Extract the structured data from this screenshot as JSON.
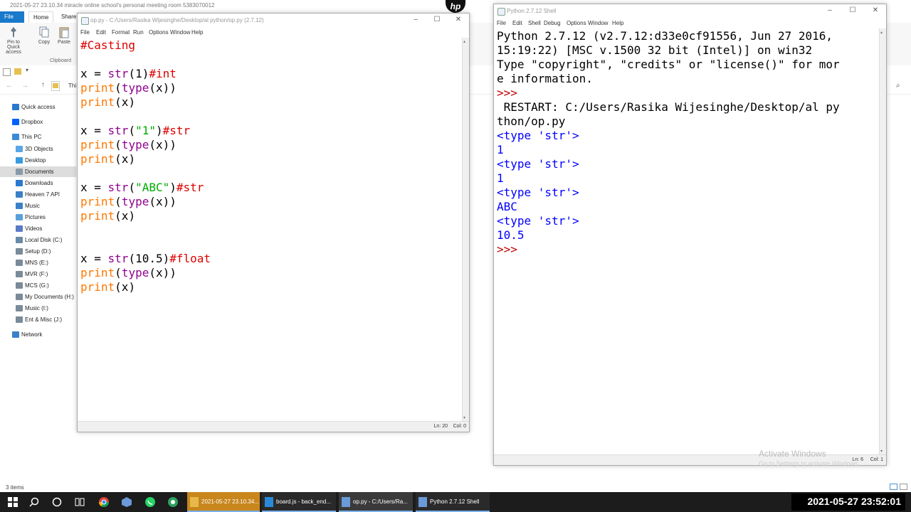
{
  "explorer": {
    "title": "2021-05-27 23.10.34 miracle online school's personal meeting room 5383070012",
    "tabs": {
      "file": "File",
      "home": "Home",
      "share": "Share"
    },
    "ribbon": {
      "pin": "Pin to Quick access",
      "copy": "Copy",
      "paste": "Paste",
      "group": "Clipboard"
    },
    "address_fragment": "Thi",
    "nav": [
      {
        "label": "Quick access",
        "icon": "star-icon",
        "color": "#2b78d0"
      },
      {
        "label": "Dropbox",
        "icon": "dropbox-icon",
        "color": "#0061fe"
      },
      {
        "label": "This PC",
        "icon": "computer-icon",
        "color": "#3b8ad8"
      },
      {
        "label": "3D Objects",
        "icon": "cube-icon",
        "color": "#58a6e8"
      },
      {
        "label": "Desktop",
        "icon": "desktop-icon",
        "color": "#3a9ae0"
      },
      {
        "label": "Documents",
        "icon": "document-icon",
        "color": "#8a9aa8"
      },
      {
        "label": "Downloads",
        "icon": "download-icon",
        "color": "#2b78d0"
      },
      {
        "label": "Heaven 7 API",
        "icon": "folder-icon",
        "color": "#3a80c8"
      },
      {
        "label": "Music",
        "icon": "music-icon",
        "color": "#3a80c8"
      },
      {
        "label": "Pictures",
        "icon": "pictures-icon",
        "color": "#5aa0d8"
      },
      {
        "label": "Videos",
        "icon": "video-icon",
        "color": "#5a7ac8"
      },
      {
        "label": "Local Disk (C:)",
        "icon": "drive-icon",
        "color": "#6a8aa8"
      },
      {
        "label": "Setup (D:)",
        "icon": "drive-icon",
        "color": "#7a8a98"
      },
      {
        "label": "MNS (E:)",
        "icon": "drive-icon",
        "color": "#7a8a98"
      },
      {
        "label": "MVR (F:)",
        "icon": "drive-icon",
        "color": "#7a8a98"
      },
      {
        "label": "MCS (G:)",
        "icon": "drive-icon",
        "color": "#7a8a98"
      },
      {
        "label": "My Documents (H:)",
        "icon": "drive-icon",
        "color": "#7a8a98"
      },
      {
        "label": "Music (I:)",
        "icon": "drive-icon",
        "color": "#7a8a98"
      },
      {
        "label": "Ent & Misc (J:)",
        "icon": "drive-icon",
        "color": "#7a8a98"
      },
      {
        "label": "Network",
        "icon": "network-icon",
        "color": "#3a80c8"
      }
    ],
    "status": "3 items"
  },
  "editor": {
    "title": "op.py - C:/Users/Rasika Wijesinghe/Desktop/al python/op.py (2.7.12)",
    "menu": [
      "File",
      "Edit",
      "Format",
      "Run",
      "Options",
      "Window",
      "Help"
    ],
    "code_lines": [
      [
        {
          "t": "#Casting",
          "c": "cm"
        }
      ],
      [],
      [
        {
          "t": "x = ",
          "c": ""
        },
        {
          "t": "str",
          "c": "bi"
        },
        {
          "t": "(1)",
          "c": ""
        },
        {
          "t": "#int",
          "c": "cm"
        }
      ],
      [
        {
          "t": "print",
          "c": "kw"
        },
        {
          "t": "(",
          "c": ""
        },
        {
          "t": "type",
          "c": "bi"
        },
        {
          "t": "(x))",
          "c": ""
        }
      ],
      [
        {
          "t": "print",
          "c": "kw"
        },
        {
          "t": "(x)",
          "c": ""
        }
      ],
      [],
      [
        {
          "t": "x = ",
          "c": ""
        },
        {
          "t": "str",
          "c": "bi"
        },
        {
          "t": "(",
          "c": ""
        },
        {
          "t": "\"1\"",
          "c": "st"
        },
        {
          "t": ")",
          "c": ""
        },
        {
          "t": "#str",
          "c": "cm"
        }
      ],
      [
        {
          "t": "print",
          "c": "kw"
        },
        {
          "t": "(",
          "c": ""
        },
        {
          "t": "type",
          "c": "bi"
        },
        {
          "t": "(x))",
          "c": ""
        }
      ],
      [
        {
          "t": "print",
          "c": "kw"
        },
        {
          "t": "(x)",
          "c": ""
        }
      ],
      [],
      [
        {
          "t": "x = ",
          "c": ""
        },
        {
          "t": "str",
          "c": "bi"
        },
        {
          "t": "(",
          "c": ""
        },
        {
          "t": "\"ABC\"",
          "c": "st"
        },
        {
          "t": ")",
          "c": ""
        },
        {
          "t": "#str",
          "c": "cm"
        }
      ],
      [
        {
          "t": "print",
          "c": "kw"
        },
        {
          "t": "(",
          "c": ""
        },
        {
          "t": "type",
          "c": "bi"
        },
        {
          "t": "(x))",
          "c": ""
        }
      ],
      [
        {
          "t": "print",
          "c": "kw"
        },
        {
          "t": "(x)",
          "c": ""
        }
      ],
      [],
      [],
      [
        {
          "t": "x = ",
          "c": ""
        },
        {
          "t": "str",
          "c": "bi"
        },
        {
          "t": "(10.5)",
          "c": ""
        },
        {
          "t": "#float",
          "c": "cm"
        }
      ],
      [
        {
          "t": "print",
          "c": "kw"
        },
        {
          "t": "(",
          "c": ""
        },
        {
          "t": "type",
          "c": "bi"
        },
        {
          "t": "(x))",
          "c": ""
        }
      ],
      [
        {
          "t": "print",
          "c": "kw"
        },
        {
          "t": "(x)",
          "c": ""
        }
      ]
    ],
    "status_line": "Ln: 20",
    "status_col": "Col: 0"
  },
  "shell": {
    "title": "Python 2.7.12 Shell",
    "menu": [
      "File",
      "Edit",
      "Shell",
      "Debug",
      "Options",
      "Window",
      "Help"
    ],
    "lines": [
      [
        {
          "t": "Python 2.7.12 (v2.7.12:d33e0cf91556, Jun 27 2016,",
          "c": ""
        }
      ],
      [
        {
          "t": "15:19:22) [MSC v.1500 32 bit (Intel)] on win32",
          "c": ""
        }
      ],
      [
        {
          "t": "Type \"copyright\", \"credits\" or \"license()\" for mor",
          "c": ""
        }
      ],
      [
        {
          "t": "e information.",
          "c": ""
        }
      ],
      [
        {
          "t": ">>>",
          "c": "prm"
        }
      ],
      [
        {
          "t": " RESTART: C:/Users/Rasika Wijesinghe/Desktop/al py",
          "c": ""
        }
      ],
      [
        {
          "t": "thon/op.py",
          "c": ""
        }
      ],
      [
        {
          "t": "<type 'str'>",
          "c": "out"
        }
      ],
      [
        {
          "t": "1",
          "c": "out"
        }
      ],
      [
        {
          "t": "<type 'str'>",
          "c": "out"
        }
      ],
      [
        {
          "t": "1",
          "c": "out"
        }
      ],
      [
        {
          "t": "<type 'str'>",
          "c": "out"
        }
      ],
      [
        {
          "t": "ABC",
          "c": "out"
        }
      ],
      [
        {
          "t": "<type 'str'>",
          "c": "out"
        }
      ],
      [
        {
          "t": "10.5",
          "c": "out"
        }
      ],
      [
        {
          "t": ">>>",
          "c": "prm"
        }
      ]
    ],
    "status_line": "Ln: 6",
    "status_col": "Col: 1"
  },
  "watermark": {
    "line1": "Activate Windows",
    "line2": "Go to Settings to activate Windows."
  },
  "hp_logo": "hp",
  "taskbar": {
    "apps": [
      {
        "label": "2021-05-27 23.10.34...",
        "icon": "folder-icon",
        "color": "#e8b84a"
      },
      {
        "label": "board.js - back_end...",
        "icon": "vscode-icon",
        "color": "#2a8ad8"
      },
      {
        "label": "op.py - C:/Users/Ra...",
        "icon": "idle-icon",
        "color": "#6a9ad8"
      },
      {
        "label": "Python 2.7.12 Shell",
        "icon": "idle-icon",
        "color": "#6a9ad8"
      }
    ],
    "clock": "2021-05-27  23:52:01"
  }
}
